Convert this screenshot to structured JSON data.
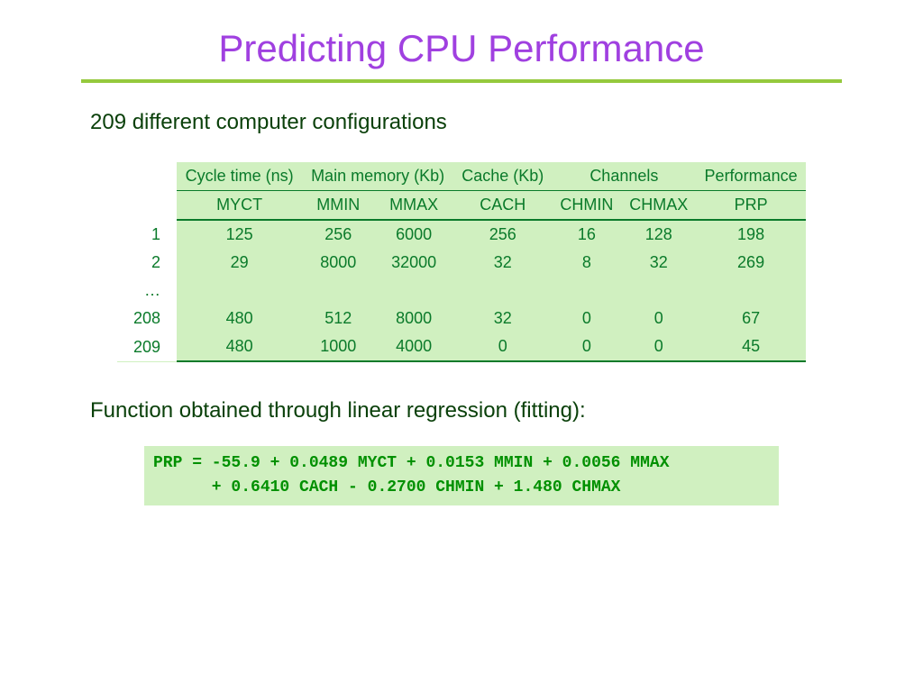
{
  "title": "Predicting CPU Performance",
  "subtitle": "209 different computer configurations",
  "table": {
    "group_headers": [
      "Cycle time (ns)",
      "Main memory (Kb)",
      "Cache (Kb)",
      "Channels",
      "Performance"
    ],
    "headers": [
      "MYCT",
      "MMIN",
      "MMAX",
      "CACH",
      "CHMIN",
      "CHMAX",
      "PRP"
    ],
    "rows": [
      {
        "idx": "1",
        "cells": [
          "125",
          "256",
          "6000",
          "256",
          "16",
          "128",
          "198"
        ]
      },
      {
        "idx": "2",
        "cells": [
          "29",
          "8000",
          "32000",
          "32",
          "8",
          "32",
          "269"
        ]
      },
      {
        "idx": "…",
        "cells": [
          "",
          "",
          "",
          "",
          "",
          "",
          ""
        ]
      },
      {
        "idx": "208",
        "cells": [
          "480",
          "512",
          "8000",
          "32",
          "0",
          "0",
          "67"
        ]
      },
      {
        "idx": "209",
        "cells": [
          "480",
          "1000",
          "4000",
          "0",
          "0",
          "0",
          "45"
        ]
      }
    ]
  },
  "function_label": "Function obtained through linear regression (fitting):",
  "formula": "PRP = -55.9 + 0.0489 MYCT + 0.0153 MMIN + 0.0056 MMAX\n      + 0.6410 CACH - 0.2700 CHMIN + 1.480 CHMAX",
  "chart_data": {
    "type": "table",
    "title": "Predicting CPU Performance",
    "columns": [
      "MYCT",
      "MMIN",
      "MMAX",
      "CACH",
      "CHMIN",
      "CHMAX",
      "PRP"
    ],
    "column_groups": {
      "Cycle time (ns)": [
        "MYCT"
      ],
      "Main memory (Kb)": [
        "MMIN",
        "MMAX"
      ],
      "Cache (Kb)": [
        "CACH"
      ],
      "Channels": [
        "CHMIN",
        "CHMAX"
      ],
      "Performance": [
        "PRP"
      ]
    },
    "rows": [
      {
        "row": 1,
        "MYCT": 125,
        "MMIN": 256,
        "MMAX": 6000,
        "CACH": 256,
        "CHMIN": 16,
        "CHMAX": 128,
        "PRP": 198
      },
      {
        "row": 2,
        "MYCT": 29,
        "MMIN": 8000,
        "MMAX": 32000,
        "CACH": 32,
        "CHMIN": 8,
        "CHMAX": 32,
        "PRP": 269
      },
      {
        "row": 208,
        "MYCT": 480,
        "MMIN": 512,
        "MMAX": 8000,
        "CACH": 32,
        "CHMIN": 0,
        "CHMAX": 0,
        "PRP": 67
      },
      {
        "row": 209,
        "MYCT": 480,
        "MMIN": 1000,
        "MMAX": 4000,
        "CACH": 0,
        "CHMIN": 0,
        "CHMAX": 0,
        "PRP": 45
      }
    ],
    "regression": {
      "intercept": -55.9,
      "coefficients": {
        "MYCT": 0.0489,
        "MMIN": 0.0153,
        "MMAX": 0.0056,
        "CACH": 0.641,
        "CHMIN": -0.27,
        "CHMAX": 1.48
      },
      "target": "PRP"
    },
    "n_total": 209
  }
}
